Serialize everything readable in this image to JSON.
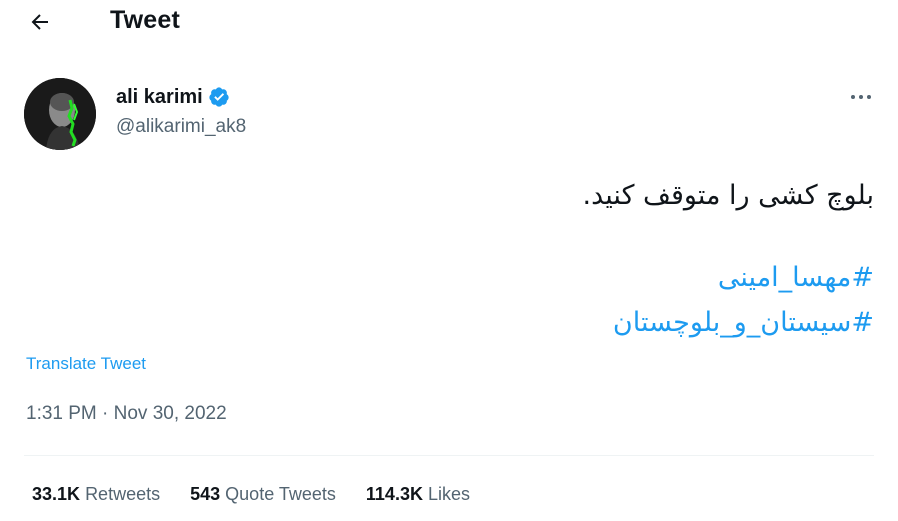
{
  "header": {
    "title": "Tweet",
    "back_icon": "arrow-left-icon"
  },
  "author": {
    "display_name": "ali karimi",
    "handle": "@alikarimi_ak8",
    "verified_icon": "verified-badge-icon",
    "verified_color": "#1d9bf0"
  },
  "more_icon": "more-horizontal-icon",
  "tweet": {
    "text": "بلوچ کشی را متوقف کنید.",
    "hashtags": [
      "#مهسا_امینی",
      "#سیستان_و_بلوچستان"
    ]
  },
  "translate_label": "Translate Tweet",
  "timestamp": "1:31 PM · Nov 30, 2022",
  "stats": [
    {
      "count": "33.1K",
      "label": "Retweets"
    },
    {
      "count": "543",
      "label": "Quote Tweets"
    },
    {
      "count": "114.3K",
      "label": "Likes"
    }
  ],
  "colors": {
    "accent": "#1d9bf0",
    "text": "#0f1419",
    "muted": "#536471"
  }
}
